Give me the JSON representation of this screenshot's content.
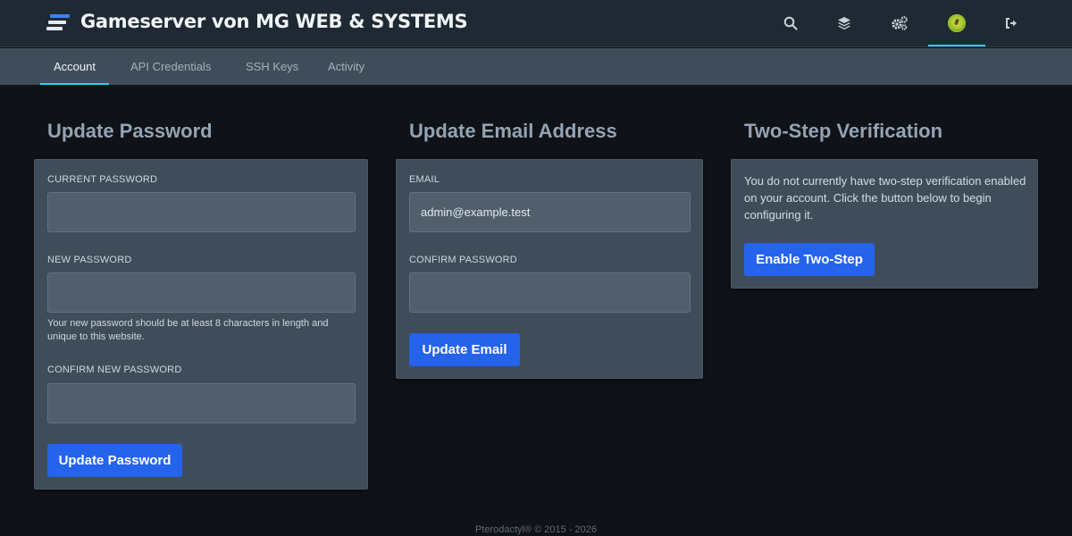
{
  "header": {
    "title": "Gameserver von MG WEB & SYSTEMS",
    "icons": [
      "search-icon",
      "layers-icon",
      "cogs-icon",
      "avatar",
      "sign-out-icon"
    ]
  },
  "subnav": {
    "tabs": [
      {
        "label": "Account",
        "active": true
      },
      {
        "label": "API Credentials",
        "active": false
      },
      {
        "label": "SSH Keys",
        "active": false
      },
      {
        "label": "Activity",
        "active": false
      }
    ]
  },
  "update_password": {
    "title": "Update Password",
    "current_label": "CURRENT PASSWORD",
    "current_value": "",
    "new_label": "NEW PASSWORD",
    "new_value": "",
    "help": "Your new password should be at least 8 characters in length and unique to this website.",
    "confirm_label": "CONFIRM NEW PASSWORD",
    "confirm_value": "",
    "button": "Update Password"
  },
  "update_email": {
    "title": "Update Email Address",
    "email_label": "EMAIL",
    "email_value": "admin@example.test",
    "confirm_label": "CONFIRM PASSWORD",
    "confirm_value": "",
    "button": "Update Email"
  },
  "two_step": {
    "title": "Two-Step Verification",
    "description": "You do not currently have two-step verification enabled on your account. Click the button below to begin configuring it.",
    "button": "Enable Two-Step"
  },
  "footer": {
    "text": "Pterodactyl® © 2015 - 2026"
  },
  "colors": {
    "accent": "#2563eb",
    "tab_indicator": "#22d3ee",
    "background": "#0f1217",
    "card": "#3f4d5a"
  }
}
